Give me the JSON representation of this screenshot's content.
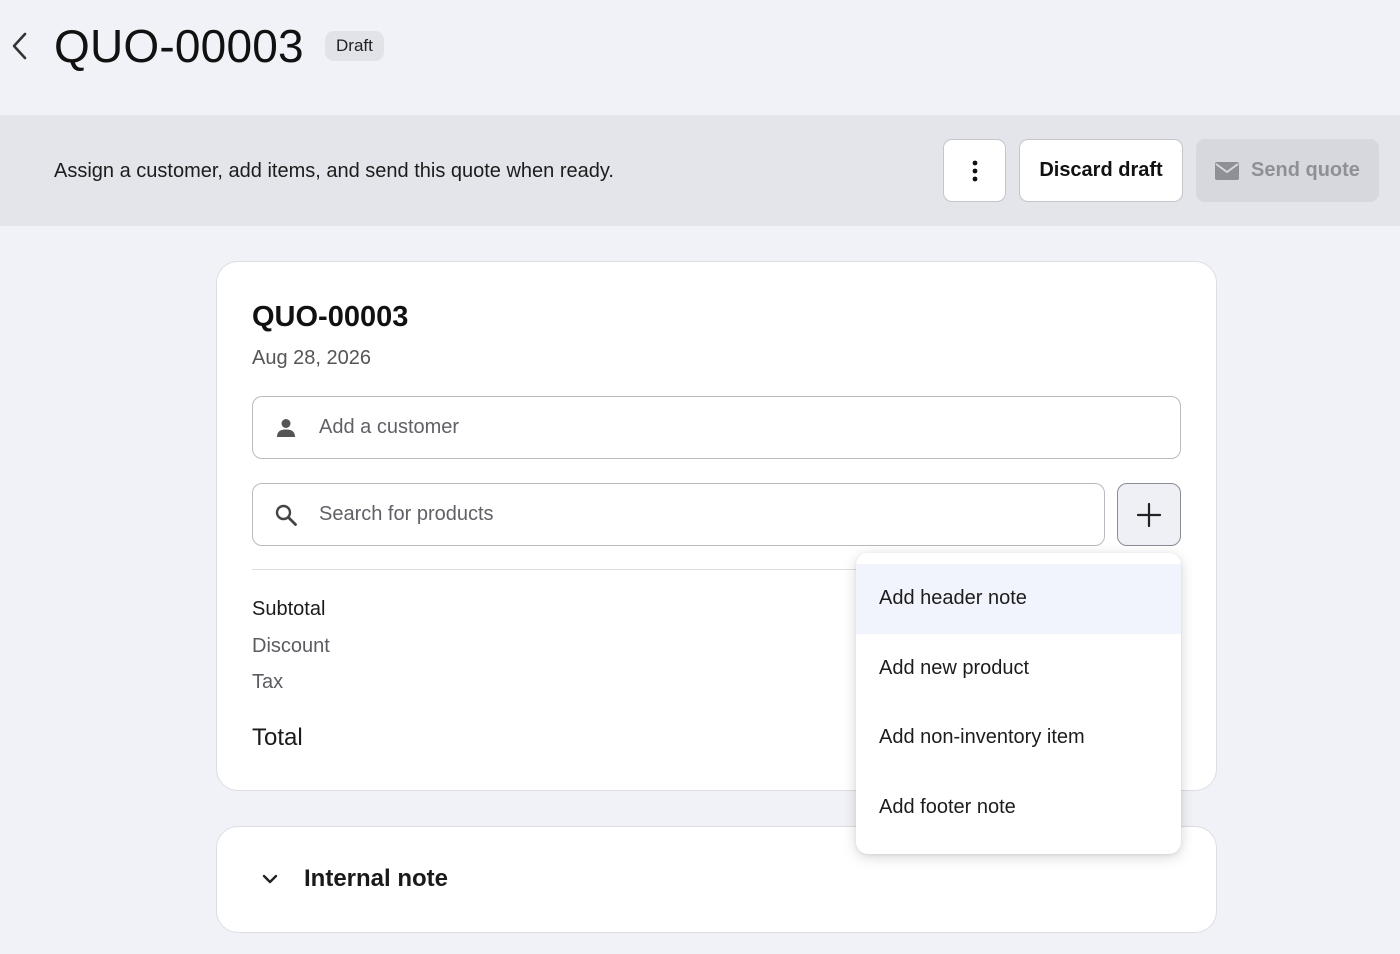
{
  "header": {
    "title": "QUO-00003",
    "status": "Draft"
  },
  "banner": {
    "message": "Assign a customer, add items, and send this quote when ready.",
    "discard_label": "Discard draft",
    "send_label": "Send quote"
  },
  "quote": {
    "number": "QUO-00003",
    "date": "Aug 28, 2026",
    "customer_placeholder": "Add a customer",
    "customer_value": "",
    "search_placeholder": "Search for products",
    "search_value": "",
    "summary": {
      "subtotal": "Subtotal",
      "discount": "Discount",
      "tax": "Tax",
      "total": "Total"
    }
  },
  "notes": {
    "title": "Internal note"
  },
  "add_menu": {
    "items": [
      {
        "label": "Add header note"
      },
      {
        "label": "Add new product"
      },
      {
        "label": "Add non-inventory item"
      },
      {
        "label": "Add footer note"
      }
    ]
  },
  "colors": {
    "page_bg": "#f0f2f7",
    "banner_bg": "#e3e5ea",
    "disabled_bg": "#d6d8dd",
    "highlight_bg": "#f1f4fc"
  },
  "icons": {
    "back": "chevron-left-icon",
    "more": "vertical-dots-icon",
    "send": "envelope-icon",
    "customer": "person-icon",
    "search": "search-icon",
    "add": "plus-icon",
    "notes_toggle": "chevron-down-icon"
  }
}
